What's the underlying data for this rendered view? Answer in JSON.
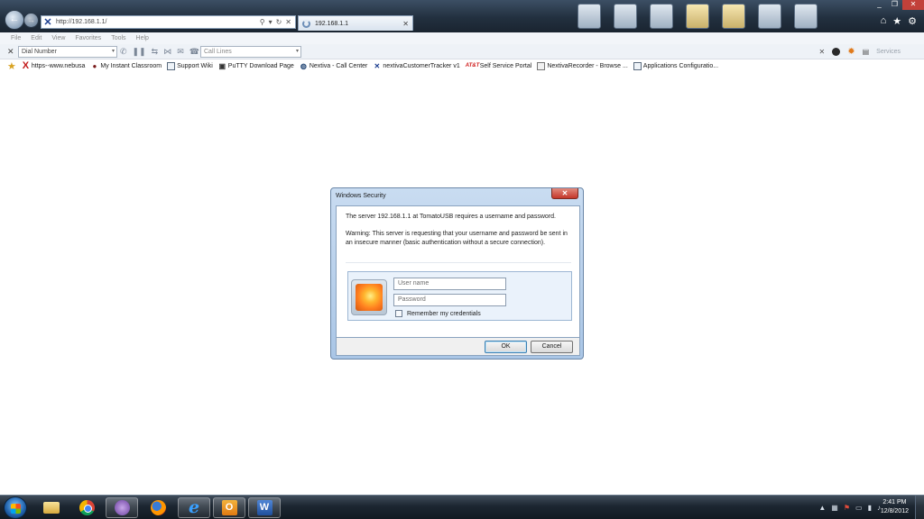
{
  "browser": {
    "address_url": "http://192.168.1.1/",
    "tab_title": "192.168.1.1",
    "menu": [
      "File",
      "Edit",
      "View",
      "Favorites",
      "Tools",
      "Help"
    ],
    "dial_number_placeholder": "Dial Number",
    "call_lines_placeholder": "Call Lines",
    "services_label": "Services",
    "favorites": [
      {
        "label": "https--www.nebusa",
        "icon": "x-logo-icon"
      },
      {
        "label": "My Instant Classroom",
        "icon": "apple-icon"
      },
      {
        "label": "Support Wiki",
        "icon": "page-icon"
      },
      {
        "label": "PuTTY Download Page",
        "icon": "putty-icon"
      },
      {
        "label": "Nextiva - Call Center",
        "icon": "globe-icon"
      },
      {
        "label": "nextivaCustomerTracker v1",
        "icon": "ie-x-icon"
      },
      {
        "label": "Self Service Portal",
        "icon": "att-icon"
      },
      {
        "label": "NextivaRecorder - Browse ...",
        "icon": "chart-icon"
      },
      {
        "label": "Applications Configuratio...",
        "icon": "page-icon"
      }
    ]
  },
  "dialog": {
    "title": "Windows Security",
    "message": "The server 192.168.1.1 at TomatoUSB requires a username and password.",
    "warning": "Warning: This server is requesting that your username and password be sent in an insecure manner (basic authentication without a secure connection).",
    "username_placeholder": "User name",
    "password_placeholder": "Password",
    "remember_label": "Remember my credentials",
    "ok_label": "OK",
    "cancel_label": "Cancel"
  },
  "taskbar": {
    "time": "2:41 PM",
    "date": "12/8/2012",
    "apps": [
      "explorer",
      "chrome",
      "purple-app",
      "firefox",
      "internet-explorer",
      "outlook",
      "word"
    ]
  }
}
